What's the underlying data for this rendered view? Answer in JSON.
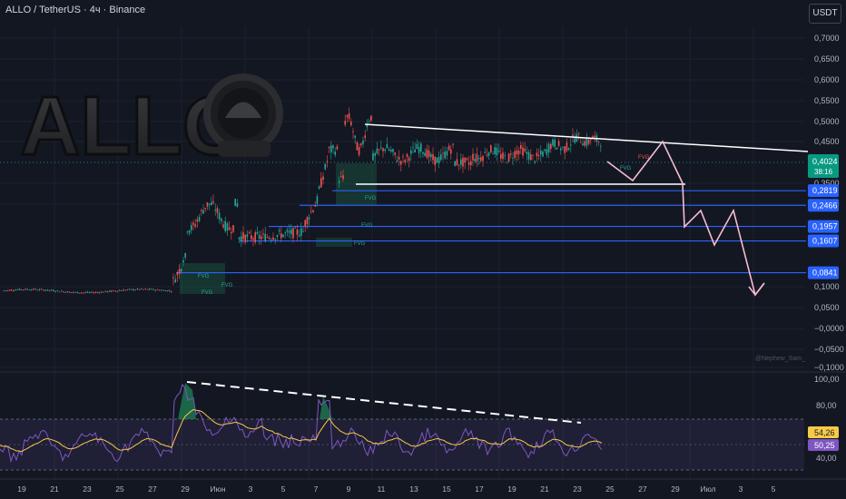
{
  "header": {
    "title": "ALLO / TetherUS · 4ч · Binance",
    "currency": "USDT"
  },
  "logo_text": "ALLO",
  "watermark": "@Nephew_Sam_",
  "price_axis": [
    "0,7000",
    "0,6500",
    "0,6000",
    "0,5500",
    "0,5000",
    "0,4500",
    "0,3500",
    "0,3000",
    "0,1000",
    "0,0500",
    "−0,0000",
    "−0,0500",
    "−0,1000"
  ],
  "levels": [
    {
      "label": "0,2819",
      "price": 0.2819
    },
    {
      "label": "0,2466",
      "price": 0.2466
    },
    {
      "label": "0,1957",
      "price": 0.1957
    },
    {
      "label": "0,1607",
      "price": 0.1607
    },
    {
      "label": "0,0841",
      "price": 0.0841
    }
  ],
  "current_price": {
    "label": "0,4024",
    "countdown": "38:16",
    "price": 0.4024
  },
  "fvg_labels": [
    "FVG",
    "FVG",
    "FVG",
    "FVG",
    "FVG",
    "FVG",
    "FVG",
    "FVG"
  ],
  "rsi": {
    "axis": [
      "100,00",
      "80,00",
      "40,00"
    ],
    "ma_label": "54,26",
    "rsi_label": "50,25"
  },
  "date_axis": [
    "19",
    "21",
    "23",
    "25",
    "27",
    "29",
    "Июн",
    "3",
    "5",
    "7",
    "9",
    "11",
    "13",
    "15",
    "17",
    "19",
    "21",
    "23",
    "25",
    "27",
    "29",
    "Июл",
    "3",
    "5"
  ],
  "colors": {
    "background": "#131722",
    "up": "#26a69a",
    "down": "#ef5350",
    "level": "#2962ff",
    "rsi": "#7e57c2",
    "rsi_ma": "#f7c948",
    "projection": "#f8bbd0"
  }
}
